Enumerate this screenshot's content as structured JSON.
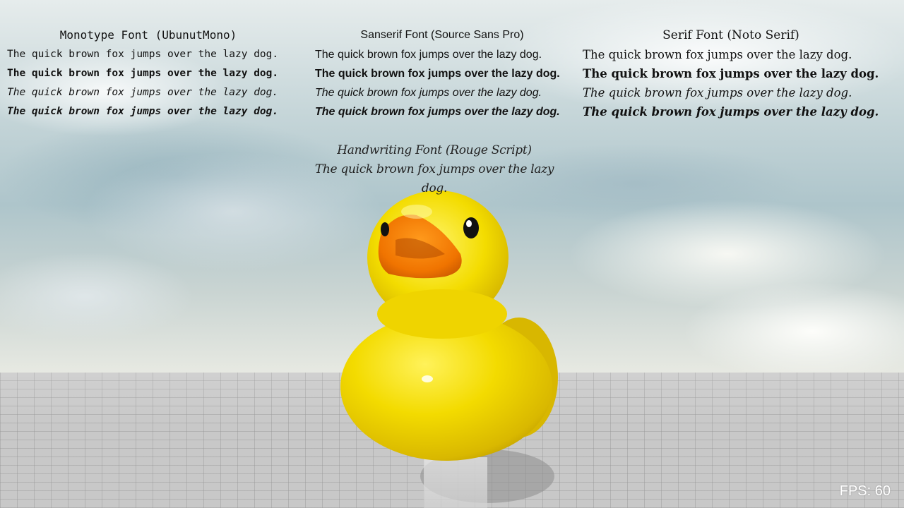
{
  "fonts": {
    "monotype": {
      "title": "Monotype Font (UbunutMono)",
      "samples": {
        "regular": "The quick brown fox jumps over the lazy dog.",
        "bold": "The quick brown fox jumps over the lazy dog.",
        "italic": "The quick brown fox jumps over the lazy dog.",
        "bold_italic": "The quick brown fox jumps over the lazy dog."
      }
    },
    "sanserif": {
      "title": "Sanserif Font (Source Sans Pro)",
      "samples": {
        "regular": "The quick brown fox jumps over the lazy dog.",
        "bold": "The quick brown fox jumps over the lazy dog.",
        "italic": "The quick brown fox jumps over the lazy dog.",
        "bold_italic": "The quick brown fox jumps over the lazy dog."
      }
    },
    "serif": {
      "title": "Serif Font (Noto Serif)",
      "samples": {
        "regular": "The quick brown fox jumps over the lazy dog.",
        "bold": "The quick brown fox jumps over the lazy dog.",
        "italic": "The quick brown fox jumps over the lazy dog.",
        "bold_italic": "The quick brown fox jumps over the lazy dog."
      }
    },
    "handwriting": {
      "title": "Handwriting Font (Rouge Script)",
      "sample": "The quick brown fox jumps over the lazy dog."
    }
  },
  "hud": {
    "fps": "FPS: 60"
  },
  "colors": {
    "duck_body": "#f5dc00",
    "duck_beak": "#f07a00",
    "text": "#111111",
    "fps_text": "#ffffff"
  }
}
